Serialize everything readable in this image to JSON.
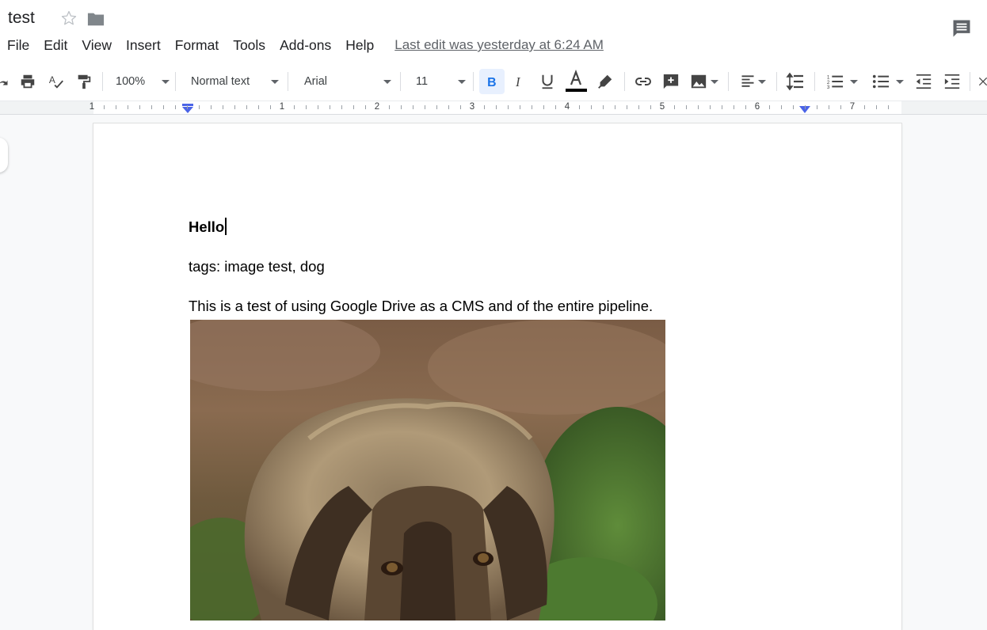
{
  "app": {
    "title": "test",
    "icons": [
      "star-icon",
      "folder-icon",
      "comment-icon"
    ]
  },
  "menu": {
    "items": [
      "File",
      "Edit",
      "View",
      "Insert",
      "Format",
      "Tools",
      "Add-ons",
      "Help"
    ],
    "last_edit": "Last edit was yesterday at 6:24 AM"
  },
  "toolbar": {
    "zoom": "100%",
    "style": "Normal text",
    "font": "Arial",
    "size": "11",
    "bold_active": true,
    "text_color": "#000000",
    "accent": "#1a73e8",
    "icons": [
      "redo-icon",
      "print-icon",
      "spellcheck-icon",
      "paint-format-icon",
      "bold-icon",
      "italic-icon",
      "underline-icon",
      "text-color-icon",
      "highlight-icon",
      "link-icon",
      "insert-comment-icon",
      "insert-image-icon",
      "align-icon",
      "line-spacing-icon",
      "numbered-list-icon",
      "bulleted-list-icon",
      "decrease-indent-icon",
      "increase-indent-icon"
    ]
  },
  "ruler": {
    "numbers": [
      "1",
      "1",
      "2",
      "3",
      "4",
      "5",
      "6",
      "7"
    ]
  },
  "document": {
    "heading": "Hello",
    "tags_line": "tags: image test, dog",
    "body_line": "This is a test of using Google Drive as a CMS and of the entire pipeline.",
    "image": "dog-photo"
  }
}
